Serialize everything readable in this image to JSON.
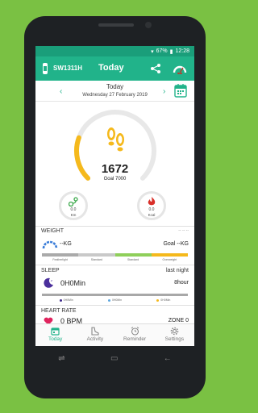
{
  "status_bar": {
    "battery": "67%",
    "time": "12:28"
  },
  "app_bar": {
    "device_name": "SW1311H",
    "title": "Today",
    "share_icon": "share-icon",
    "gauge_icon": "gauge-icon"
  },
  "date_bar": {
    "day": "Today",
    "date": "Wednesday 27 February 2019",
    "prev_arrow": "‹",
    "next_arrow": "›"
  },
  "steps": {
    "value": "1672",
    "goal_text": "Goal 7000",
    "progress": 0.24,
    "accent": "#f5b91c",
    "track": "#e8e8e8"
  },
  "distance": {
    "value": "0.0",
    "unit": "Km"
  },
  "calories": {
    "value": "0.0",
    "unit": "Kcal"
  },
  "weight": {
    "label": "WEIGHT",
    "dashes": "-- -- --",
    "value": "--KG",
    "goal": "Goal --KG",
    "scale": [
      {
        "label": "Featherlight",
        "color": "#aaaaaa"
      },
      {
        "label": "Standard",
        "color": "#c9c9c9"
      },
      {
        "label": "Standard",
        "color": "#8fcf5a"
      },
      {
        "label": "Overweight",
        "color": "#f5b91c"
      }
    ]
  },
  "sleep": {
    "label": "SLEEP",
    "right_label": "last night",
    "value": "0H0Min",
    "target": "8hour",
    "legend": [
      {
        "label": "0H0Min",
        "color": "#3f2a8c"
      },
      {
        "label": "0H0Min",
        "color": "#5fa8e0"
      },
      {
        "label": "0H0Min",
        "color": "#f5b91c"
      }
    ]
  },
  "heart_rate": {
    "label": "HEART RATE",
    "value": "0 BPM",
    "zone": "ZONE 0"
  },
  "nav": [
    {
      "label": "Today",
      "icon": "calendar-icon",
      "active": true
    },
    {
      "label": "Activity",
      "icon": "shoe-icon",
      "active": false
    },
    {
      "label": "Reminder",
      "icon": "alarm-clock-icon",
      "active": false
    },
    {
      "label": "Settings",
      "icon": "gear-icon",
      "active": false
    }
  ],
  "system_nav": {
    "recents": "⇌",
    "home": "▭",
    "back": "←"
  }
}
